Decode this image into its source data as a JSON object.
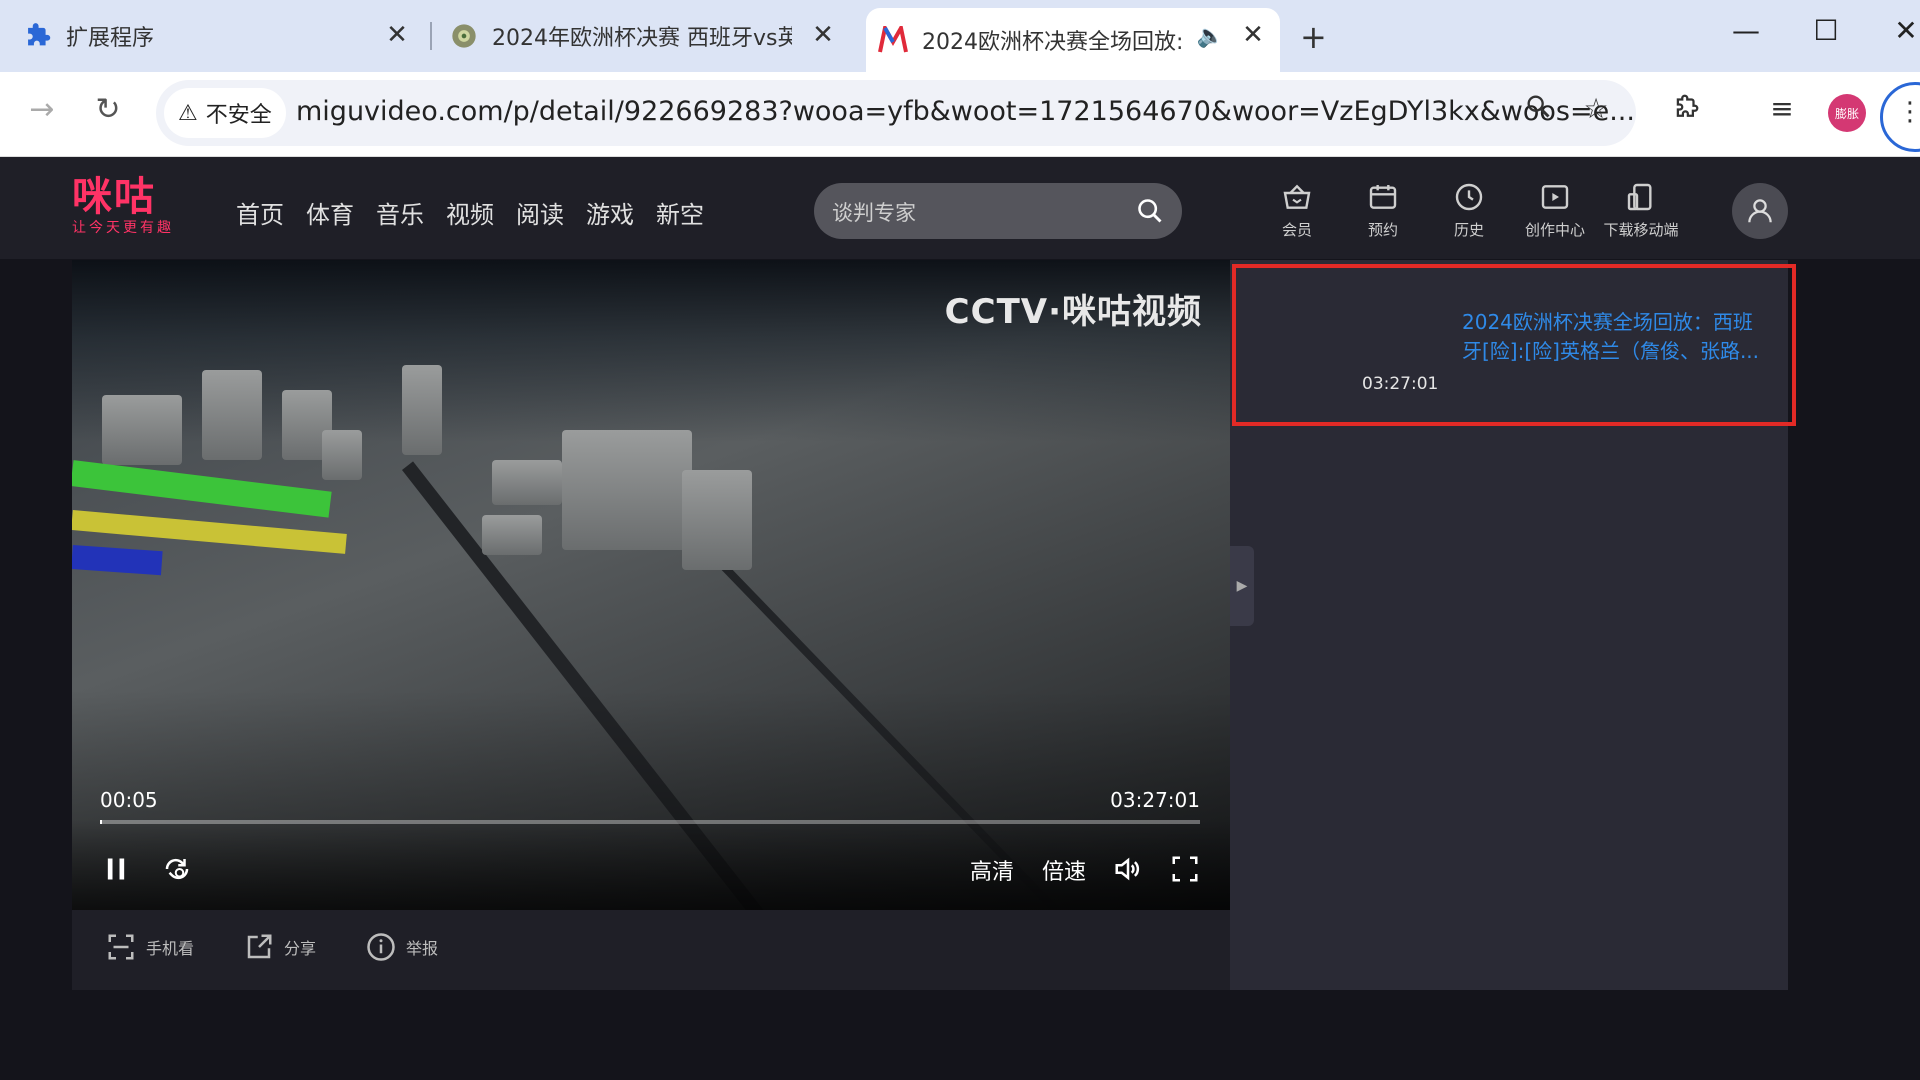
{
  "browser": {
    "tabs": [
      {
        "title": "扩展程序",
        "icon": "puzzle-icon",
        "active": false
      },
      {
        "title": "2024年欧洲杯决赛 西班牙vs英",
        "icon": "globe-icon",
        "active": false
      },
      {
        "title": "2024欧洲杯决赛全场回放:",
        "icon": "migu-m-icon",
        "active": true,
        "audio": true
      }
    ],
    "security_label": "不安全",
    "url": "miguvideo.com/p/detail/922669283?wooa=yfb&woot=1721564670&woor=VzEgDYl3kx&woos=e...",
    "profile_label": "膨胀"
  },
  "site": {
    "logo_main": "咪咕",
    "logo_tagline": "让今天更有趣",
    "nav": [
      "首页",
      "体育",
      "音乐",
      "视频",
      "阅读",
      "游戏",
      "新空"
    ],
    "search_placeholder": "谈判专家",
    "header_items": [
      {
        "label": "会员",
        "icon": "vip-basket-icon"
      },
      {
        "label": "预约",
        "icon": "calendar-icon"
      },
      {
        "label": "历史",
        "icon": "clock-icon"
      },
      {
        "label": "创作中心",
        "icon": "creator-icon"
      },
      {
        "label": "下载移动端",
        "icon": "mobile-download-icon"
      }
    ]
  },
  "player": {
    "watermark": "CCTV·咪咕视频",
    "current_time": "00:05",
    "duration": "03:27:01",
    "progress_fraction": 0.0004,
    "quality_label": "高清",
    "speed_label": "倍速"
  },
  "below_actions": [
    {
      "label": "手机看",
      "icon": "scan-icon"
    },
    {
      "label": "分享",
      "icon": "share-icon"
    },
    {
      "label": "举报",
      "icon": "info-icon"
    }
  ],
  "episode": {
    "title": "2024欧洲杯决赛全场回放：西班牙[险]:[险]英格兰（詹俊、张路...",
    "duration": "03:27:01"
  },
  "colors": {
    "brand": "#ff3366",
    "highlight_border": "#e22a26",
    "link": "#2f8ae8"
  }
}
